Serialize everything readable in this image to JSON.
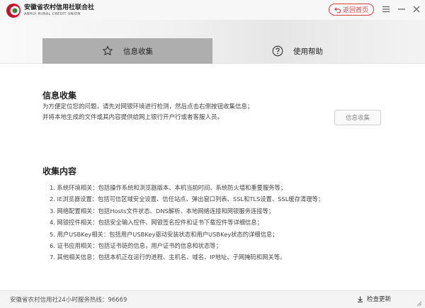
{
  "app": {
    "logo_cn": "安徽省农村信用社联合社",
    "logo_en": "ANHUI RURAL CREDIT UNION",
    "home_button": "返回首页",
    "brand_color": "#d73a3a"
  },
  "tabs": [
    {
      "label": "信息收集",
      "icon": "star-icon",
      "active": true
    },
    {
      "label": "使用帮助",
      "icon": "help-icon",
      "active": false
    }
  ],
  "info": {
    "title": "信息收集",
    "desc_line1": "为方便定位您的问题，请先对网银环境进行检测，然后点击右侧按钮收集信息；",
    "desc_line2": "并将本地生成的文件或其内容提供给网上银行开户行或者客服人员。",
    "button": "信息收集"
  },
  "content": {
    "title": "收集内容",
    "items": [
      "1. 系统环境相关：包括操作系统和浏览器版本、本机当前时间、系统防火墙和重要服务等；",
      "2. IE浏览器设置：包括可信区域安全设置、信任站点、弹出窗口列表、SSL和TLS设置、SSL缓存清理等；",
      "3. 网络配置相关：包括Hosts文件状态、DNS解析、本地网络连接和网银服务连接等；",
      "4. 网银控件相关：包括安全输入控件、网银签名控件和证书下载控件等详细信息；",
      "5. 用户USBKey相关：包括用户USBKey驱动安装状态和用户USBKey状态的详细信息；",
      "6. 证书应用相关：包括证书链的信息，用户证书的信息和状态等；",
      "7. 其他相关信息：包括本机正在运行的进程、主机名、域名、IP地址、子网掩码和网关等。"
    ]
  },
  "footer": {
    "hotline": "安徽省农村信用社24小时服务热线：96669",
    "update": "检查更新"
  }
}
